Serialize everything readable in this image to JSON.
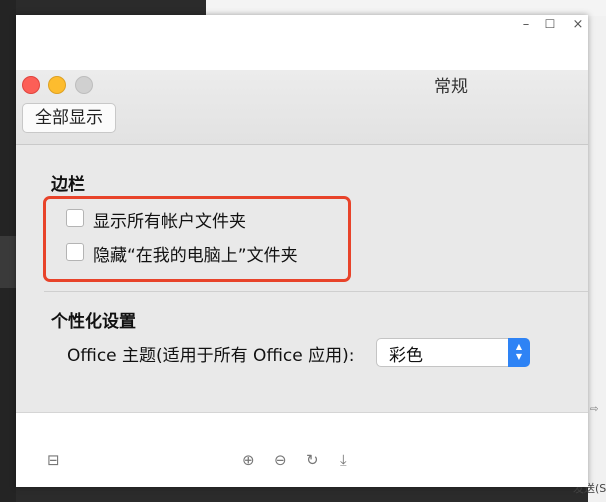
{
  "window_controls": {
    "minimize_icon": "minimize-icon",
    "maximize_icon": "maximize-icon",
    "close_icon": "close-icon",
    "minimize_glyph": "–",
    "maximize_glyph": "☐",
    "close_glyph": "×"
  },
  "prefs": {
    "title": "常规",
    "show_all_label": "全部显示",
    "sidebar_heading": "边栏",
    "checkboxes": [
      {
        "label": "显示所有帐户文件夹",
        "checked": false
      },
      {
        "label": "隐藏“在我的电脑上”文件夹",
        "checked": false
      }
    ],
    "personalize_heading": "个性化设置",
    "theme_label": "Office 主题(适用于所有 Office 应用):",
    "theme_value": "彩色",
    "highlight_color": "#e8432a",
    "select_accent": "#2e83f5"
  },
  "toolbar": {
    "panel_glyph": "⊟",
    "zoom_in_glyph": "⊕",
    "zoom_out_glyph": "⊖",
    "rotate_glyph": "↻",
    "download_glyph": "⤓"
  },
  "background": {
    "bottom_right_text": "发送(S"
  }
}
